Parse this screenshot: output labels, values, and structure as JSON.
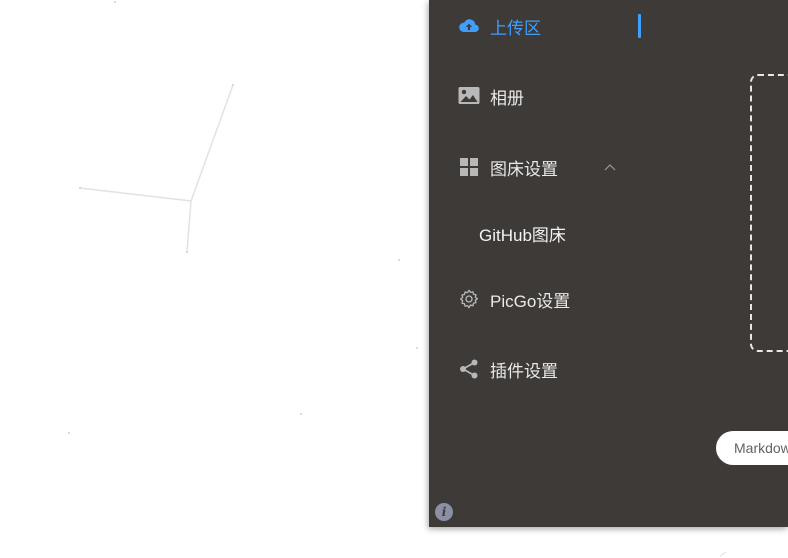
{
  "menu": {
    "upload_label": "上传区",
    "gallery_label": "相册",
    "picbed_label": "图床设置",
    "github_label": "GitHub图床",
    "picgo_settings_label": "PicGo设置",
    "plugin_label": "插件设置"
  },
  "upload": {
    "link_format_label": "Markdown"
  },
  "info": {
    "label": "i"
  },
  "colors": {
    "active": "#409eff",
    "sidebar_bg": "#3e3a37",
    "text": "#e9e9e9",
    "icon": "#b8b8b8"
  }
}
